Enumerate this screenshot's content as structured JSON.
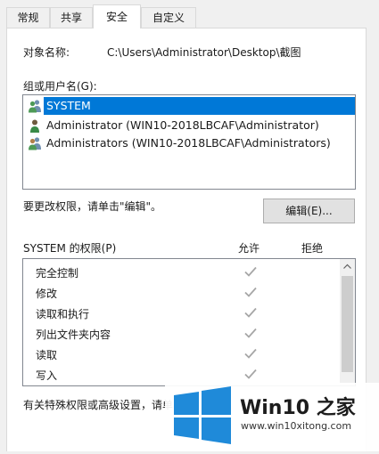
{
  "tabs": [
    {
      "label": "常规"
    },
    {
      "label": "共享"
    },
    {
      "label": "安全"
    },
    {
      "label": "自定义"
    }
  ],
  "object": {
    "label": "对象名称:",
    "value": "C:\\Users\\Administrator\\Desktop\\截图"
  },
  "groups": {
    "label": "组或用户名(G):",
    "items": [
      {
        "name": "SYSTEM",
        "selected": true
      },
      {
        "name": "Administrator (WIN10-2018LBCAF\\Administrator)"
      },
      {
        "name": "Administrators (WIN10-2018LBCAF\\Administrators)"
      }
    ]
  },
  "change_hint": "要更改权限，请单击\"编辑\"。",
  "edit_button": "编辑(E)...",
  "permissions": {
    "title": "SYSTEM 的权限(P)",
    "allow_header": "允许",
    "deny_header": "拒绝",
    "rows": [
      {
        "name": "完全控制",
        "allow": true
      },
      {
        "name": "修改",
        "allow": true
      },
      {
        "name": "读取和执行",
        "allow": true
      },
      {
        "name": "列出文件夹内容",
        "allow": true
      },
      {
        "name": "读取",
        "allow": true
      },
      {
        "name": "写入",
        "allow": true
      }
    ]
  },
  "advanced_hint": "有关特殊权限或高级设置，请单",
  "watermark": {
    "brand": "Win10 之家",
    "url": "www.win10xitong.com"
  },
  "colors": {
    "selection": "#0078d7",
    "check": "#a6a6a6",
    "logo_blue": "#1f8ad9"
  }
}
